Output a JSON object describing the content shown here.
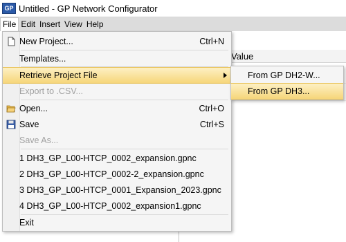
{
  "window": {
    "title": "Untitled - GP Network Configurator",
    "icon_label": "GP"
  },
  "menubar": {
    "items": [
      "File",
      "Edit",
      "Insert",
      "View",
      "Help"
    ]
  },
  "table": {
    "column_header": "Value"
  },
  "file_menu": {
    "items": [
      {
        "label": "New Project...",
        "shortcut": "Ctrl+N",
        "icon": "new-document-icon"
      },
      {
        "label": "Templates..."
      },
      {
        "label": "Retrieve Project File",
        "submenu": true
      },
      {
        "label": "Export to .CSV...",
        "disabled": true
      },
      {
        "label": "Open...",
        "shortcut": "Ctrl+O",
        "icon": "open-folder-icon"
      },
      {
        "label": "Save",
        "shortcut": "Ctrl+S",
        "icon": "save-disk-icon"
      },
      {
        "label": "Save As...",
        "disabled": true
      },
      {
        "label": "1 DH3_GP_L00-HTCP_0002_expansion.gpnc"
      },
      {
        "label": "2 DH3_GP_L00-HTCP_0002-2_expansion.gpnc"
      },
      {
        "label": "3 DH3_GP_L00-HTCP_0001_Expansion_2023.gpnc"
      },
      {
        "label": "4 DH3_GP_L00-HTCP_0002_expansion1.gpnc"
      },
      {
        "label": "Exit"
      }
    ]
  },
  "retrieve_submenu": {
    "items": [
      {
        "label": "From GP DH2-W..."
      },
      {
        "label": "From GP DH3..."
      }
    ]
  },
  "colors": {
    "highlight": "#f6d67a",
    "menubar": "#dcdcdc"
  }
}
